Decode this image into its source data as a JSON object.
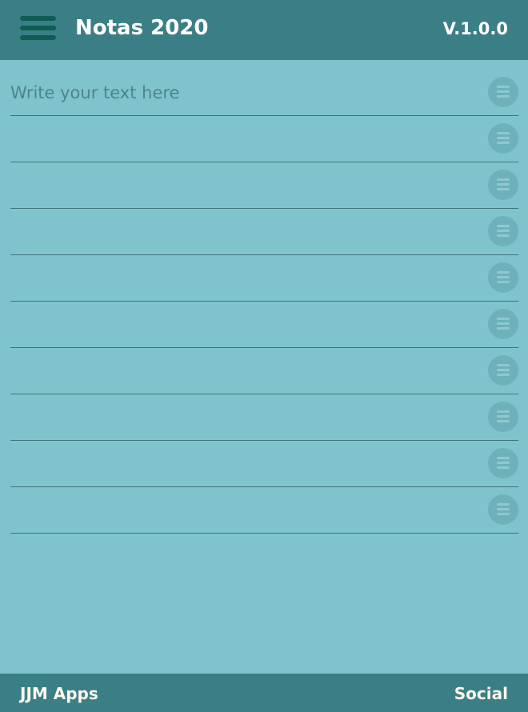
{
  "header": {
    "title": "Notas 2020",
    "version": "V.1.0.0",
    "menu_icon": "hamburger-menu-icon"
  },
  "notes": {
    "placeholder": "Write your text here",
    "handle_icon": "drag-handle-icon",
    "rows": [
      {
        "value": ""
      },
      {
        "value": ""
      },
      {
        "value": ""
      },
      {
        "value": ""
      },
      {
        "value": ""
      },
      {
        "value": ""
      },
      {
        "value": ""
      },
      {
        "value": ""
      },
      {
        "value": ""
      },
      {
        "value": ""
      }
    ]
  },
  "footer": {
    "left_label": "JJM Apps",
    "right_label": "Social"
  },
  "colors": {
    "background": "#7fc4cc",
    "bar": "#3b7f86",
    "menu_icon": "#0f5c55"
  }
}
